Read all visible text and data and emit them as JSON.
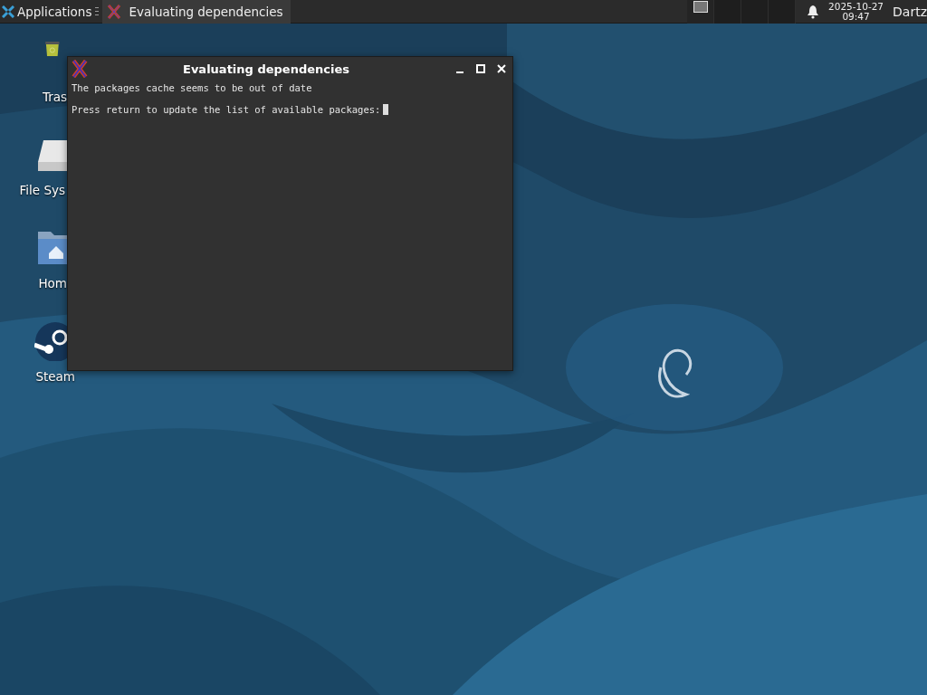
{
  "taskbar": {
    "menu_label": "Applications",
    "tasks": [
      {
        "title": "Evaluating dependencies",
        "selected": true
      }
    ],
    "workspaces": [
      {
        "selected": true
      },
      {
        "selected": false
      },
      {
        "selected": false
      },
      {
        "selected": false
      }
    ],
    "clock": {
      "date": "2025-10-27",
      "time": "09:47"
    },
    "user": "Dartz"
  },
  "desktop_icons": [
    {
      "kind": "trash",
      "label": "Tras"
    },
    {
      "kind": "drive",
      "label": "File Sys"
    },
    {
      "kind": "home",
      "label": "Hom"
    },
    {
      "kind": "steam",
      "label": "Steam"
    }
  ],
  "window": {
    "title": "Evaluating dependencies",
    "lines": [
      "The packages cache seems to be out of date",
      "Press return to update the list of available packages:"
    ]
  }
}
